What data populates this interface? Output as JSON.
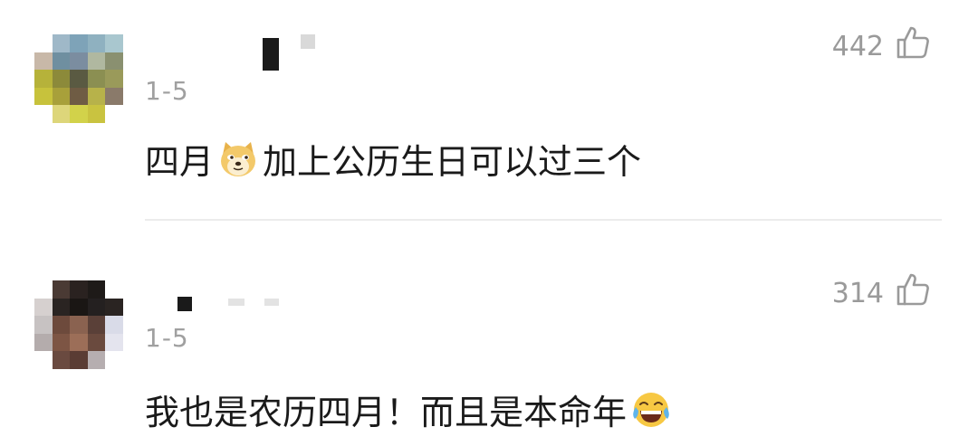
{
  "comments": [
    {
      "time": "1-5",
      "likes": "442",
      "text_before": "四月",
      "emoji": "doge-emoji",
      "text_after": "加上公历生日可以过三个"
    },
    {
      "time": "1-5",
      "likes": "314",
      "text_before": "我也是农历四月！而且是本命年",
      "emoji": "laughing-tears-emoji",
      "text_after": ""
    }
  ],
  "icons": {
    "like": "thumbs-up-outline-icon"
  },
  "colors": {
    "meta_gray": "#a0a0a0",
    "text": "#1a1a1a",
    "divider": "#ececec"
  }
}
